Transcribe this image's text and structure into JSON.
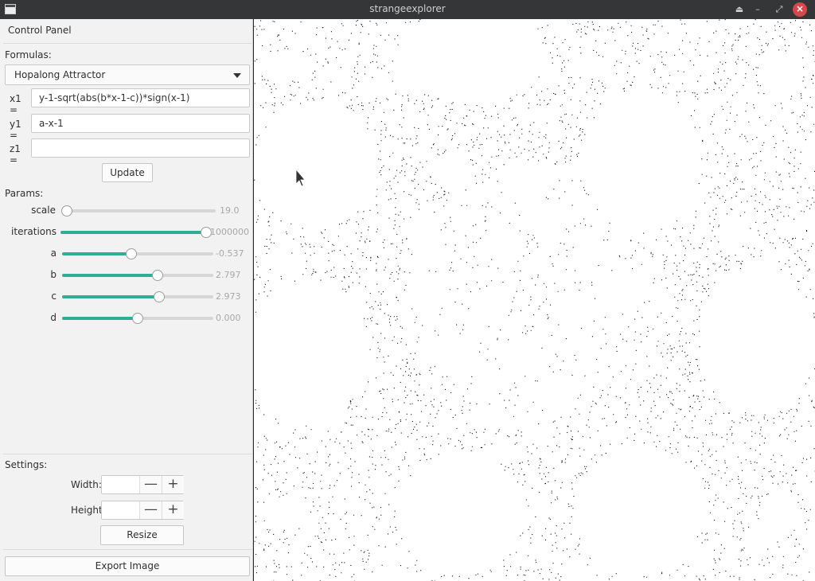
{
  "window": {
    "title": "strangeexplorer"
  },
  "panel": {
    "title": "Control Panel",
    "formulas_label": "Formulas:",
    "selected_formula": "Hopalong Attractor",
    "x1_label": "x1 =",
    "x1_value": "y-1-sqrt(abs(b*x-1-c))*sign(x-1)",
    "y1_label": "y1 =",
    "y1_value": "a-x-1",
    "z1_label": "z1 =",
    "z1_value": "",
    "update_label": "Update",
    "params_label": "Params:",
    "params": [
      {
        "name": "scale",
        "value": "19.0",
        "level": 0.0
      },
      {
        "name": "iterations",
        "value": "1000000",
        "level": 1.0
      },
      {
        "name": "a",
        "value": "-0.537",
        "level": 0.46
      },
      {
        "name": "b",
        "value": "2.797",
        "level": 0.63
      },
      {
        "name": "c",
        "value": "2.973",
        "level": 0.64
      },
      {
        "name": "d",
        "value": "0.000",
        "level": 0.5
      }
    ],
    "settings_label": "Settings:",
    "width_label": "Width:",
    "width_value": "",
    "height_label": "Height",
    "height_value": "",
    "minus": "—",
    "plus": "+",
    "resize_label": "Resize",
    "export_label": "Export Image"
  },
  "icons": {
    "app": "window-icon",
    "controls": [
      "eject-icon",
      "minimize-icon",
      "restore-icon",
      "close-icon"
    ]
  },
  "colors": {
    "accent": "#2fae96",
    "titlebar": "#343638",
    "close": "#d3484b"
  }
}
